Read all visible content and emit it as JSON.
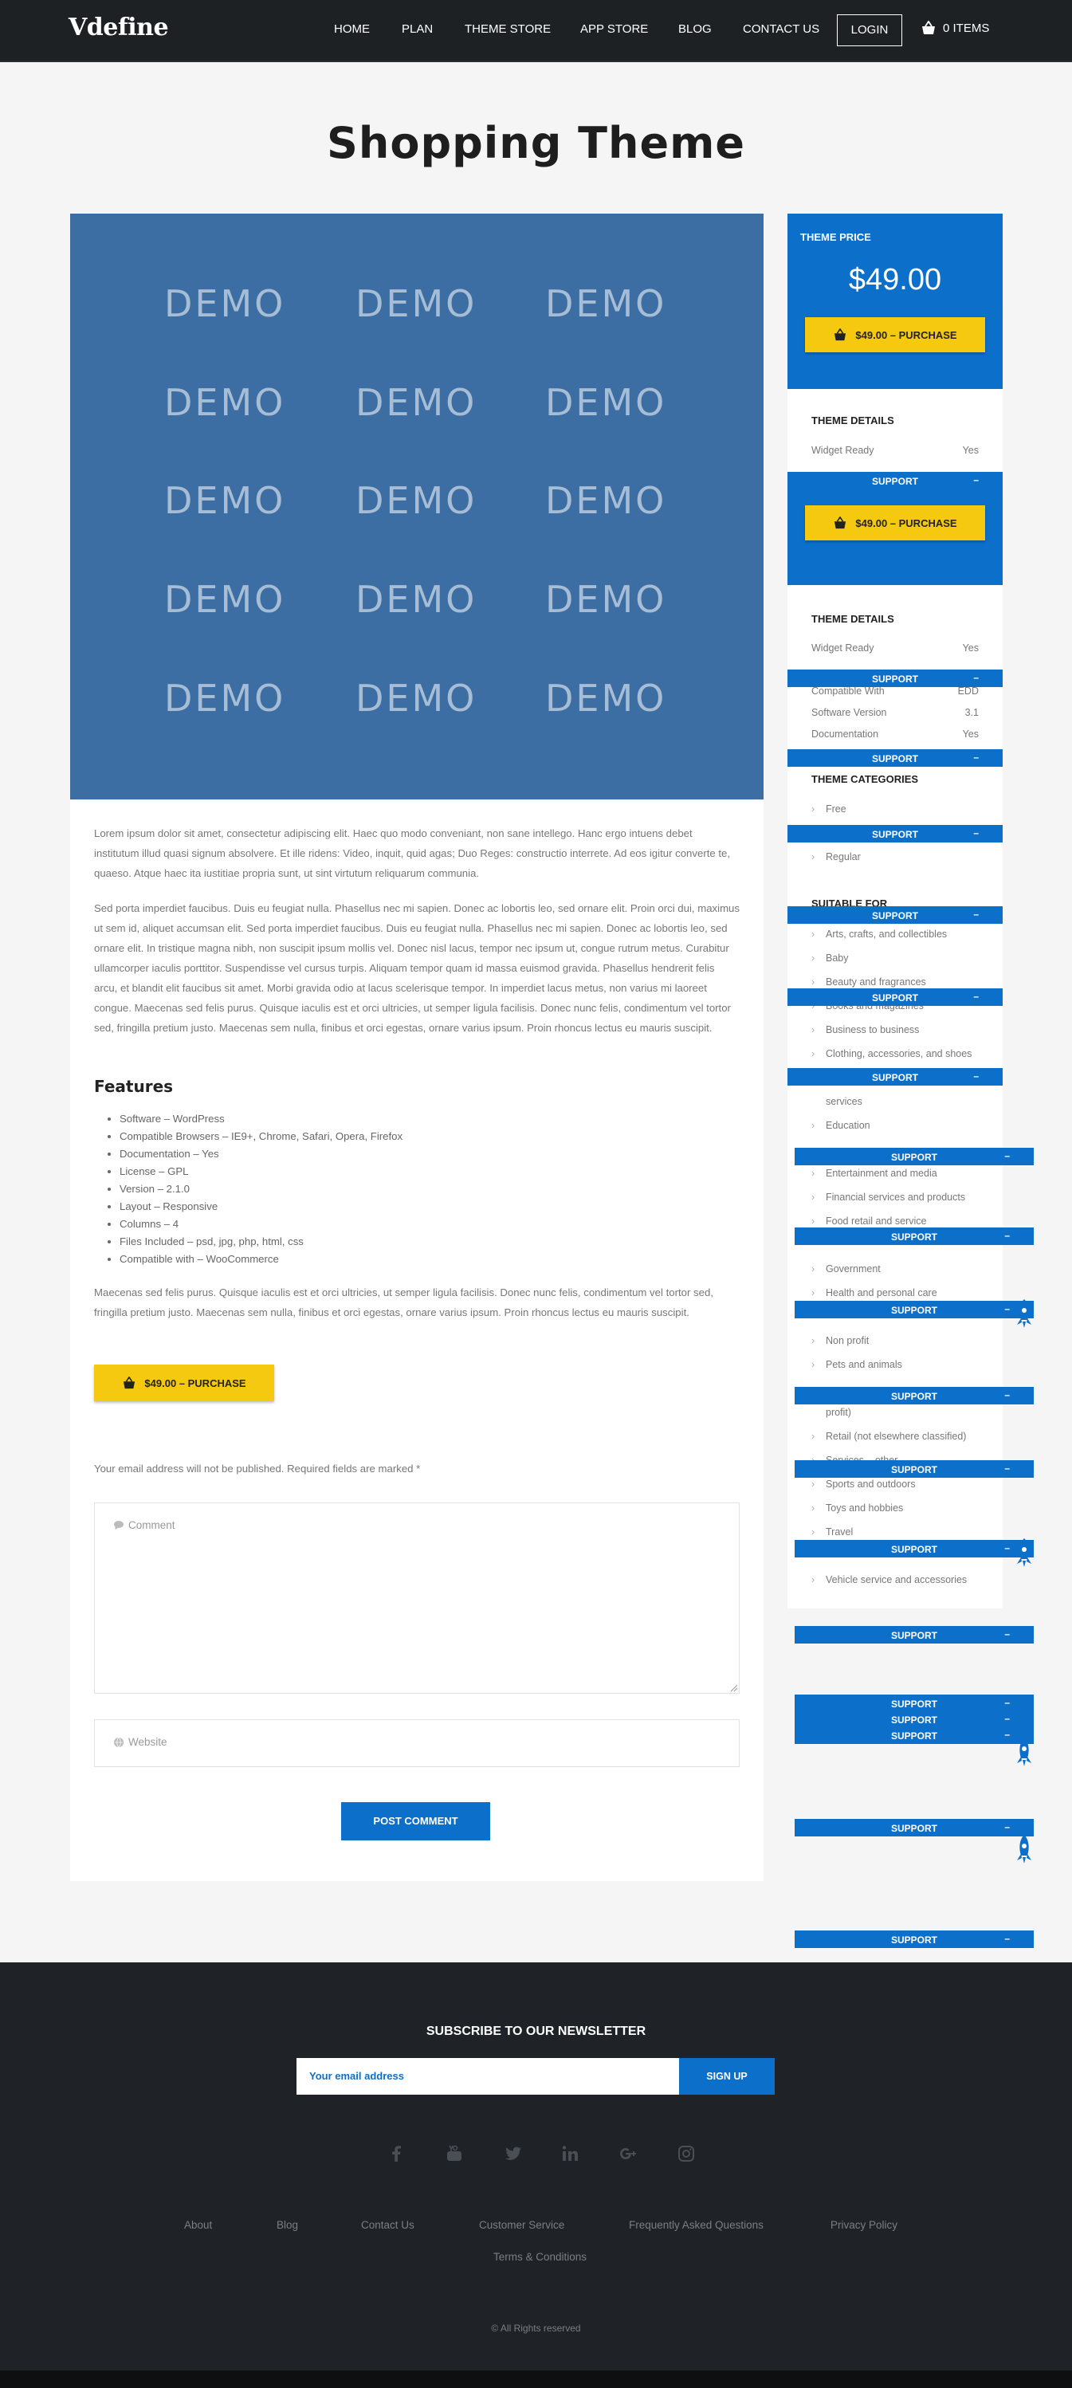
{
  "nav": {
    "logo": "Vdefine",
    "links": [
      "HOME",
      "PLAN",
      "THEME STORE",
      "APP STORE",
      "BLOG",
      "CONTACT US"
    ],
    "login": "LOGIN",
    "cart": "0 ITEMS"
  },
  "page_title": "Shopping Theme",
  "demo_word": "DEMO",
  "content": {
    "para1": "Lorem ipsum dolor sit amet, consectetur adipiscing elit. Haec quo modo conveniant, non sane intellego. Hanc ergo intuens debet institutum illud quasi signum absolvere. Et ille ridens: Video, inquit, quid agas; Duo Reges: constructio interrete. Ad eos igitur converte te, quaeso. Atque haec ita iustitiae propria sunt, ut sint virtutum reliquarum communia.",
    "para2": "Sed porta imperdiet faucibus. Duis eu feugiat nulla. Phasellus nec mi sapien. Donec ac lobortis leo, sed ornare elit. Proin orci dui, maximus ut sem id, aliquet accumsan elit. Sed porta imperdiet faucibus. Duis eu feugiat nulla. Phasellus nec mi sapien. Donec ac lobortis leo, sed ornare elit. In tristique magna nibh, non suscipit ipsum mollis vel. Donec nisl lacus, tempor nec ipsum ut, congue rutrum metus. Curabitur ullamcorper iaculis porttitor. Suspendisse vel cursus turpis. Aliquam tempor quam id massa euismod gravida. Phasellus hendrerit felis arcu, et blandit elit faucibus sit amet. Morbi gravida odio at lacus scelerisque tempor. In imperdiet lacus metus, non varius mi laoreet congue. Maecenas sed felis purus. Quisque iaculis est et orci ultricies, ut semper ligula facilisis. Donec nunc felis, condimentum vel tortor sed, fringilla pretium justo. Maecenas sem nulla, finibus et orci egestas, ornare varius ipsum. Proin rhoncus lectus eu mauris suscipit.",
    "features_heading": "Features",
    "features": [
      "Software – WordPress",
      "Compatible Browsers – IE9+, Chrome, Safari, Opera, Firefox",
      "Documentation – Yes",
      "License – GPL",
      "Version – 2.1.0",
      "Layout – Responsive",
      "Columns – 4",
      "Files Included – psd, jpg, php, html, css",
      "Compatible with – WooCommerce"
    ],
    "para3": "Maecenas sed felis purus. Quisque iaculis est et orci ultricies, ut semper ligula facilisis. Donec nunc felis, condimentum vel tortor sed, fringilla pretium justo. Maecenas sem nulla, finibus et orci egestas, ornare varius ipsum. Proin rhoncus lectus eu mauris suscipit.",
    "purchase_label": "$49.00 – PURCHASE",
    "email_note": "Your email address will not be published. Required fields are marked *",
    "comment_placeholder": "Comment",
    "website_placeholder": "Website",
    "post_comment": "POST COMMENT"
  },
  "sidebar": {
    "price_label": "THEME PRICE",
    "price": "$49.00",
    "purchase_label": "$49.00 – PURCHASE",
    "details_heading": "THEME DETAILS",
    "details": [
      {
        "k": "Widget Ready",
        "v": "Yes"
      },
      {
        "k": "Compatible With",
        "v": "EDD"
      },
      {
        "k": "Software Version",
        "v": "3.1"
      },
      {
        "k": "Documentation",
        "v": "Yes"
      }
    ],
    "categories_heading": "THEME CATEGORIES",
    "categories": [
      "Free",
      "Regular"
    ],
    "suitable_heading": "SUITABLE FOR",
    "suitable": [
      "Arts, crafts, and collectibles",
      "Baby",
      "Beauty and fragrances",
      "Books and magazines",
      "Business to business",
      "Clothing, accessories, and shoes",
      "services",
      "Education",
      "Entertainment and media",
      "Financial services and products",
      "Food retail and service",
      "Government",
      "Health and personal care",
      "Non profit",
      "Pets and animals",
      "profit)",
      "Retail (not elsewhere classified)",
      "Services – other",
      "Sports and outdoors",
      "Toys and hobbies",
      "Travel",
      "Vehicle service and accessories"
    ],
    "support_label": "SUPPORT",
    "support_mark": "–"
  },
  "footer": {
    "newsletter_heading": "SUBSCRIBE TO OUR NEWSLETTER",
    "email_placeholder": "Your email address",
    "signup": "SIGN UP",
    "social": [
      "facebook-icon",
      "youtube-icon",
      "twitter-icon",
      "linkedin-icon",
      "google-plus-icon",
      "instagram-icon"
    ],
    "links": [
      "About",
      "Blog",
      "Contact Us",
      "Customer Service",
      "Frequently Asked Questions",
      "Privacy Policy",
      "Terms & Conditions"
    ],
    "copyright": "© All Rights reserved"
  },
  "colors": {
    "accent": "#0c6fca",
    "buy": "#f5c90f",
    "dark": "#1f2226",
    "demo": "#3c6ea3"
  }
}
